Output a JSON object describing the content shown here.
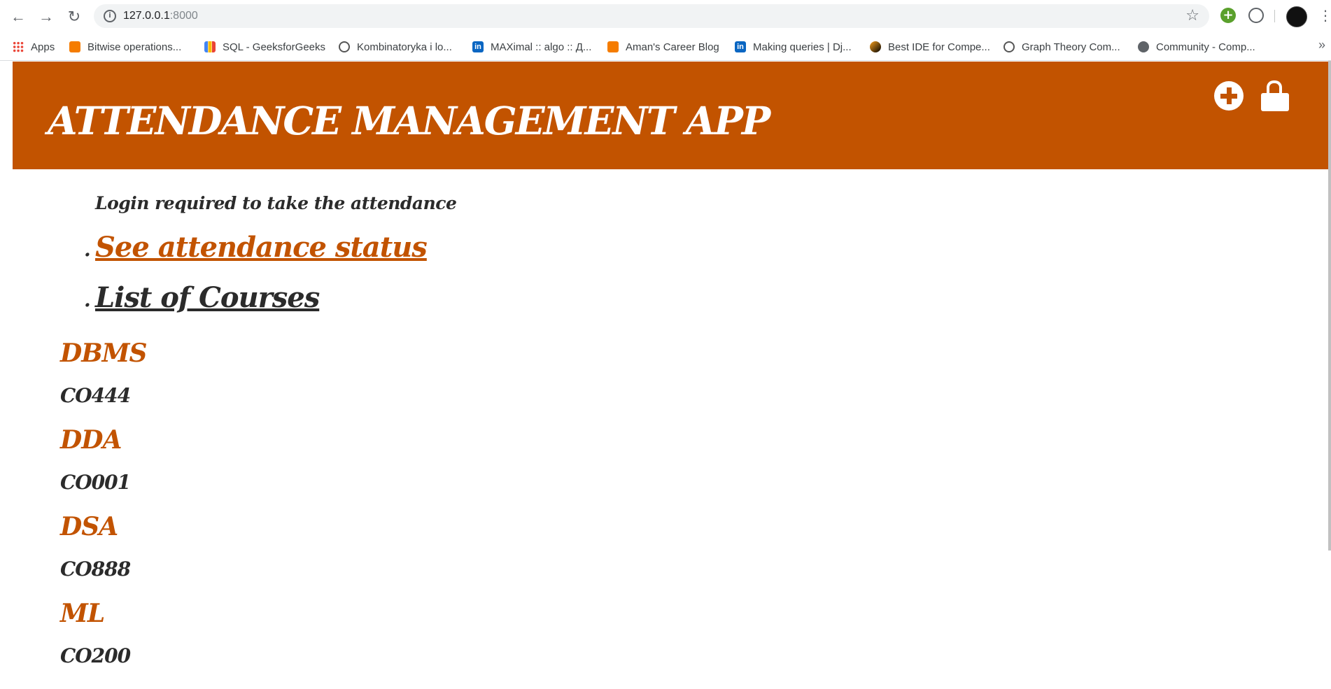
{
  "browser": {
    "url_host": "127.0.0.1",
    "url_port": ":8000",
    "bookmarks": [
      {
        "label": "Apps",
        "icon": "apps-grid-icon"
      },
      {
        "label": "Bitwise operations...",
        "icon": "blogger-icon"
      },
      {
        "label": "SQL - GeeksforGeeks",
        "icon": "bar-chart-icon"
      },
      {
        "label": "Kombinatoryka i lo...",
        "icon": "triangle-site-icon"
      },
      {
        "label": "MAXimal :: algo :: Д...",
        "icon": "linkedin-icon"
      },
      {
        "label": "Aman's Career Blog",
        "icon": "blogger-icon"
      },
      {
        "label": "Making queries | Dj...",
        "icon": "linkedin-icon"
      },
      {
        "label": "Best IDE for Compe...",
        "icon": "leetcode-icon"
      },
      {
        "label": "Graph Theory Com...",
        "icon": "triangle-site-icon"
      },
      {
        "label": "Community - Comp...",
        "icon": "globe-icon"
      }
    ],
    "more_label": "»"
  },
  "header": {
    "title": "ATTENDANCE MANAGEMENT APP",
    "accent_color": "#c25300",
    "actions": [
      "plus-circle-icon",
      "lock-icon"
    ]
  },
  "main": {
    "login_note": "Login required to take the attendance",
    "bullet": ".",
    "links": {
      "attendance_status": "See attendance status",
      "list_of_courses": "List of Courses"
    },
    "courses": [
      {
        "name": "DBMS",
        "code": "CO444"
      },
      {
        "name": "DDA",
        "code": "CO001"
      },
      {
        "name": "DSA",
        "code": "CO888"
      },
      {
        "name": "ML",
        "code": "CO200"
      }
    ]
  }
}
